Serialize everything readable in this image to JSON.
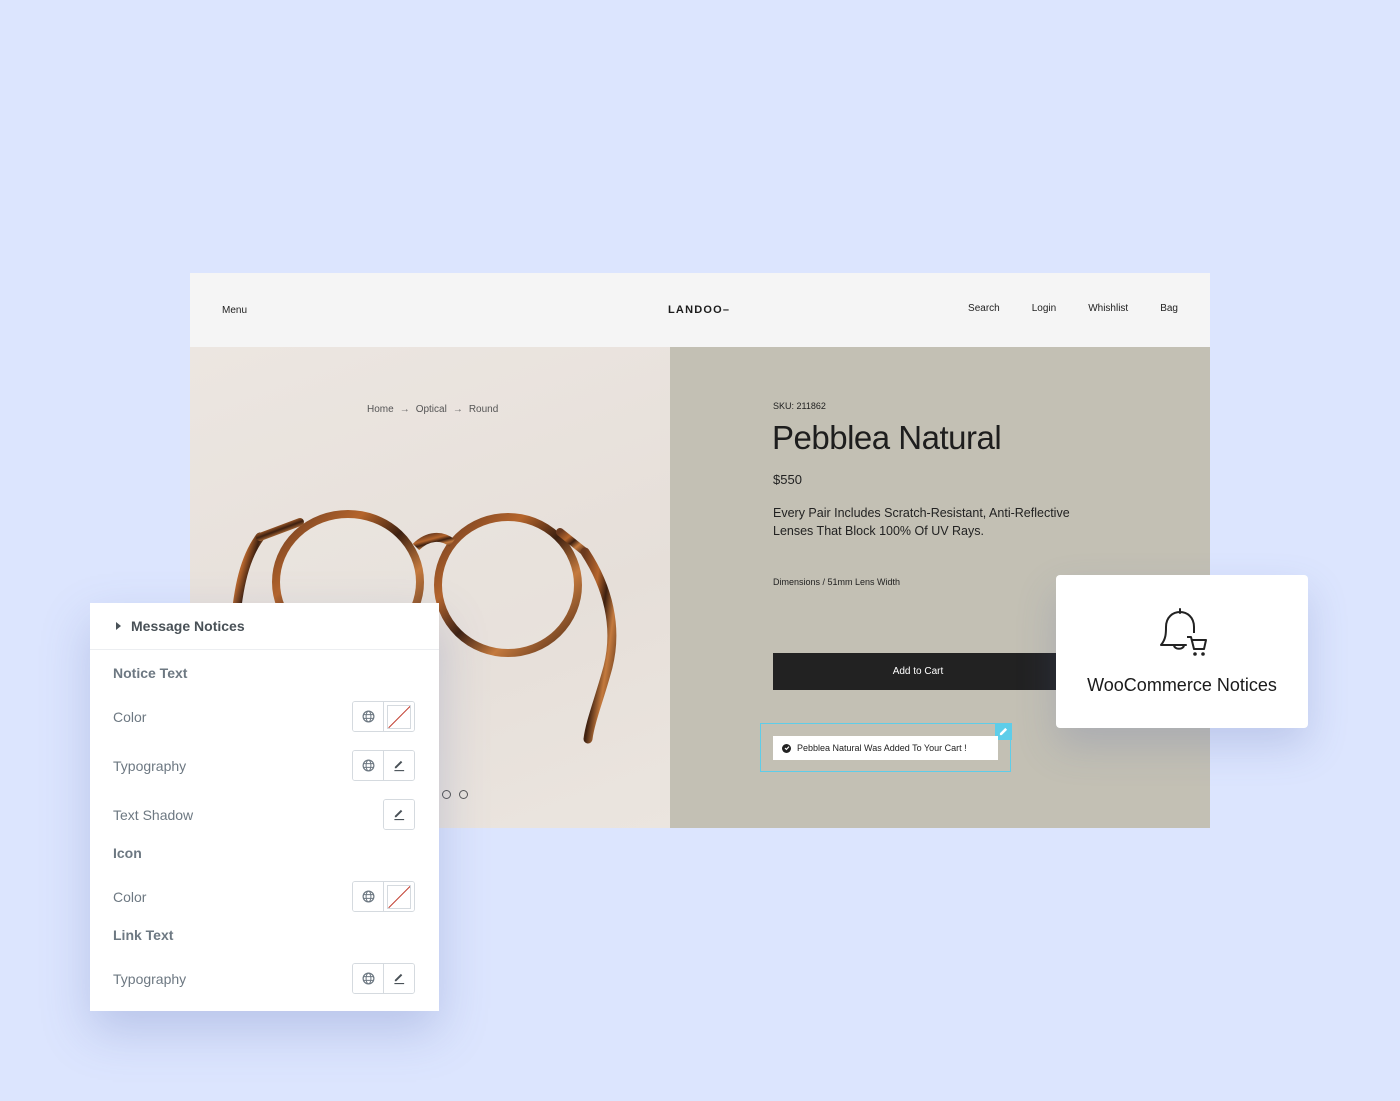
{
  "site": {
    "header": {
      "menu": "Menu",
      "logo": "LANDOO–",
      "nav": [
        "Search",
        "Login",
        "Whishlist",
        "Bag"
      ]
    },
    "breadcrumb": [
      "Home",
      "Optical",
      "Round"
    ],
    "breadcrumb_separator": "→",
    "product": {
      "sku": "SKU: 211862",
      "title": "Pebblea Natural",
      "price": "$550",
      "description": "Every Pair Includes Scratch-Resistant, Anti-Reflective Lenses That Block 100% Of UV Rays.",
      "dimensions": "Dimensions / 51mm Lens Width",
      "add_to_cart": "Add to Cart"
    },
    "notice": {
      "message": "Pebblea Natural Was Added To Your Cart !"
    },
    "slider_dots": 2
  },
  "widget_card": {
    "icon": "bell-cart-icon",
    "label": "WooCommerce Notices"
  },
  "panel": {
    "title": "Message Notices",
    "rows": [
      {
        "type": "section",
        "label": "Notice Text"
      },
      {
        "type": "control",
        "label": "Color",
        "controls": [
          "globe",
          "color-swatch"
        ]
      },
      {
        "type": "control",
        "label": "Typography",
        "controls": [
          "globe",
          "edit"
        ]
      },
      {
        "type": "control",
        "label": "Text Shadow",
        "controls": [
          "edit"
        ]
      },
      {
        "type": "section",
        "label": "Icon"
      },
      {
        "type": "control",
        "label": "Color",
        "controls": [
          "globe",
          "color-swatch"
        ]
      },
      {
        "type": "section",
        "label": "Link Text"
      },
      {
        "type": "control",
        "label": "Typography",
        "controls": [
          "globe",
          "edit"
        ]
      }
    ]
  },
  "colors": {
    "background": "#dce5fe",
    "hero_right": "#c3c0b4",
    "button": "#222222",
    "selection": "#5ecde9"
  }
}
